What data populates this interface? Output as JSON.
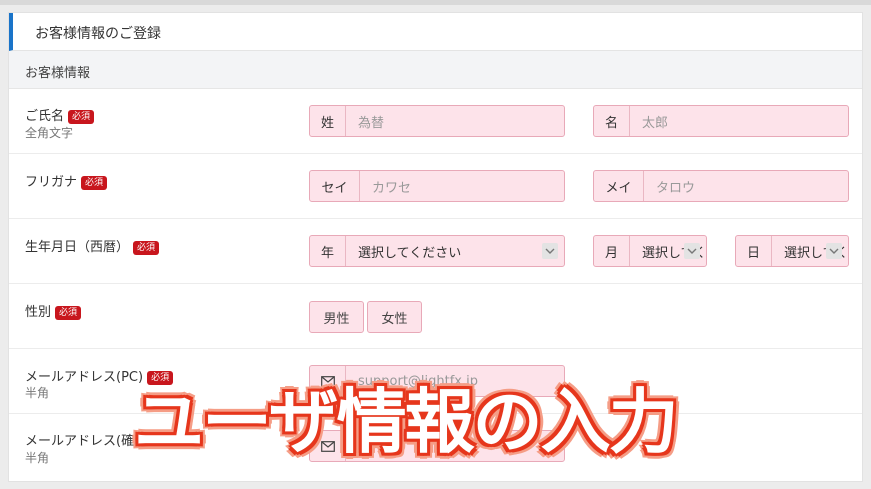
{
  "card": {
    "title": "お客様情報のご登録"
  },
  "section": {
    "title": "お客様情報"
  },
  "required_badge": "必須",
  "rows": {
    "name": {
      "label": "ご氏名",
      "sub": "全角文字",
      "last": {
        "prefix": "姓",
        "placeholder": "為替"
      },
      "first": {
        "prefix": "名",
        "placeholder": "太郎"
      }
    },
    "kana": {
      "label": "フリガナ",
      "last": {
        "prefix": "セイ",
        "placeholder": "カワセ"
      },
      "first": {
        "prefix": "メイ",
        "placeholder": "タロウ"
      }
    },
    "birth": {
      "label": "生年月日（西暦）",
      "year": {
        "prefix": "年",
        "value": "選択してください"
      },
      "month": {
        "prefix": "月",
        "value": "選択してください"
      },
      "day": {
        "prefix": "日",
        "value": "選択してください"
      }
    },
    "gender": {
      "label": "性別",
      "male": "男性",
      "female": "女性"
    },
    "email_pc": {
      "label": "メールアドレス(PC)",
      "sub": "半角",
      "placeholder": "support@lightfx.jp"
    },
    "email_confirm": {
      "label": "メールアドレス(確認)",
      "sub": "半角"
    }
  },
  "overlay": {
    "text": "ユーザ情報の入力"
  },
  "icons": {
    "mail": "envelope-icon",
    "select": "chevron-down-icon"
  },
  "colors": {
    "accent": "#1a74c9",
    "required": "#c8161d",
    "field_bg": "#fde3ea",
    "field_border": "#e8a9b8",
    "overlay_stroke": "#e6361c"
  }
}
